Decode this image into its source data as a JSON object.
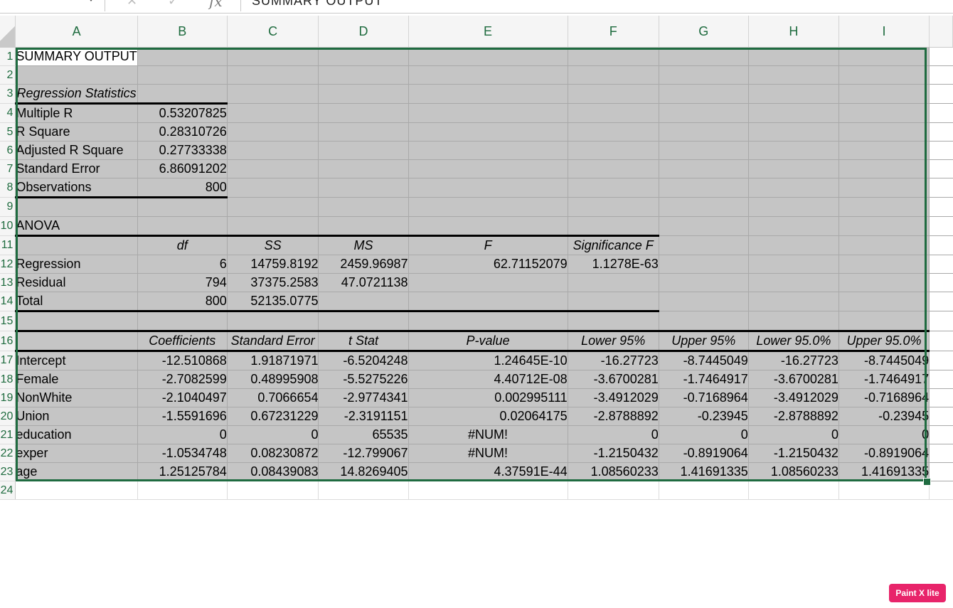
{
  "formula_bar": {
    "content": "SUMMARY OUTPUT",
    "fx": "fx"
  },
  "columns": [
    "A",
    "B",
    "C",
    "D",
    "E",
    "F",
    "G",
    "H",
    "I"
  ],
  "rows": [
    {
      "num": "1",
      "cells": [
        "SUMMARY OUTPUT",
        "",
        "",
        "",
        "",
        "",
        "",
        "",
        ""
      ]
    },
    {
      "num": "2",
      "cells": [
        "",
        "",
        "",
        "",
        "",
        "",
        "",
        "",
        ""
      ]
    },
    {
      "num": "3",
      "cells": [
        "Regression Statistics",
        "",
        "",
        "",
        "",
        "",
        "",
        "",
        ""
      ]
    },
    {
      "num": "4",
      "cells": [
        "Multiple R",
        "0.53207825",
        "",
        "",
        "",
        "",
        "",
        "",
        ""
      ]
    },
    {
      "num": "5",
      "cells": [
        "R Square",
        "0.28310726",
        "",
        "",
        "",
        "",
        "",
        "",
        ""
      ]
    },
    {
      "num": "6",
      "cells": [
        "Adjusted R Square",
        "0.27733338",
        "",
        "",
        "",
        "",
        "",
        "",
        ""
      ]
    },
    {
      "num": "7",
      "cells": [
        "Standard Error",
        "6.86091202",
        "",
        "",
        "",
        "",
        "",
        "",
        ""
      ]
    },
    {
      "num": "8",
      "cells": [
        "Observations",
        "800",
        "",
        "",
        "",
        "",
        "",
        "",
        ""
      ]
    },
    {
      "num": "9",
      "cells": [
        "",
        "",
        "",
        "",
        "",
        "",
        "",
        "",
        ""
      ]
    },
    {
      "num": "10",
      "cells": [
        "ANOVA",
        "",
        "",
        "",
        "",
        "",
        "",
        "",
        ""
      ]
    },
    {
      "num": "11",
      "cells": [
        "",
        "df",
        "SS",
        "MS",
        "F",
        "Significance F",
        "",
        "",
        ""
      ]
    },
    {
      "num": "12",
      "cells": [
        "Regression",
        "6",
        "14759.8192",
        "2459.96987",
        "62.71152079",
        "1.1278E-63",
        "",
        "",
        ""
      ]
    },
    {
      "num": "13",
      "cells": [
        "Residual",
        "794",
        "37375.2583",
        "47.0721138",
        "",
        "",
        "",
        "",
        ""
      ]
    },
    {
      "num": "14",
      "cells": [
        "Total",
        "800",
        "52135.0775",
        "",
        "",
        "",
        "",
        "",
        ""
      ]
    },
    {
      "num": "15",
      "cells": [
        "",
        "",
        "",
        "",
        "",
        "",
        "",
        "",
        ""
      ]
    },
    {
      "num": "16",
      "cells": [
        "",
        "Coefficients",
        "Standard Error",
        "t Stat",
        "P-value",
        "Lower 95%",
        "Upper 95%",
        "Lower 95.0%",
        "Upper 95.0%"
      ]
    },
    {
      "num": "17",
      "cells": [
        "Intercept",
        "-12.510868",
        "1.91871971",
        "-6.5204248",
        "1.24645E-10",
        "-16.27723",
        "-8.7445049",
        "-16.27723",
        "-8.7445049"
      ]
    },
    {
      "num": "18",
      "cells": [
        "Female",
        "-2.7082599",
        "0.48995908",
        "-5.5275226",
        "4.40712E-08",
        "-3.6700281",
        "-1.7464917",
        "-3.6700281",
        "-1.7464917"
      ]
    },
    {
      "num": "19",
      "cells": [
        "NonWhite",
        "-2.1040497",
        "0.7066654",
        "-2.9774341",
        "0.002995111",
        "-3.4912029",
        "-0.7168964",
        "-3.4912029",
        "-0.7168964"
      ]
    },
    {
      "num": "20",
      "cells": [
        "Union",
        "-1.5591696",
        "0.67231229",
        "-2.3191151",
        "0.02064175",
        "-2.8788892",
        "-0.23945",
        "-2.8788892",
        "-0.23945"
      ]
    },
    {
      "num": "21",
      "cells": [
        "education",
        "0",
        "0",
        "65535",
        "#NUM!",
        "0",
        "0",
        "0",
        "0"
      ]
    },
    {
      "num": "22",
      "cells": [
        "exper",
        "-1.0534748",
        "0.08230872",
        "-12.799067",
        "#NUM!",
        "-1.2150432",
        "-0.8919064",
        "-1.2150432",
        "-0.8919064"
      ]
    },
    {
      "num": "23",
      "cells": [
        "age",
        "1.25125784",
        "0.08439083",
        "14.8269405",
        "4.37591E-44",
        "1.08560233",
        "1.41691335",
        "1.08560233",
        "1.41691335"
      ]
    },
    {
      "num": "24",
      "cells": [
        "",
        "",
        "",
        "",
        "",
        "",
        "",
        "",
        ""
      ]
    }
  ],
  "watermark": "Paint X lite"
}
